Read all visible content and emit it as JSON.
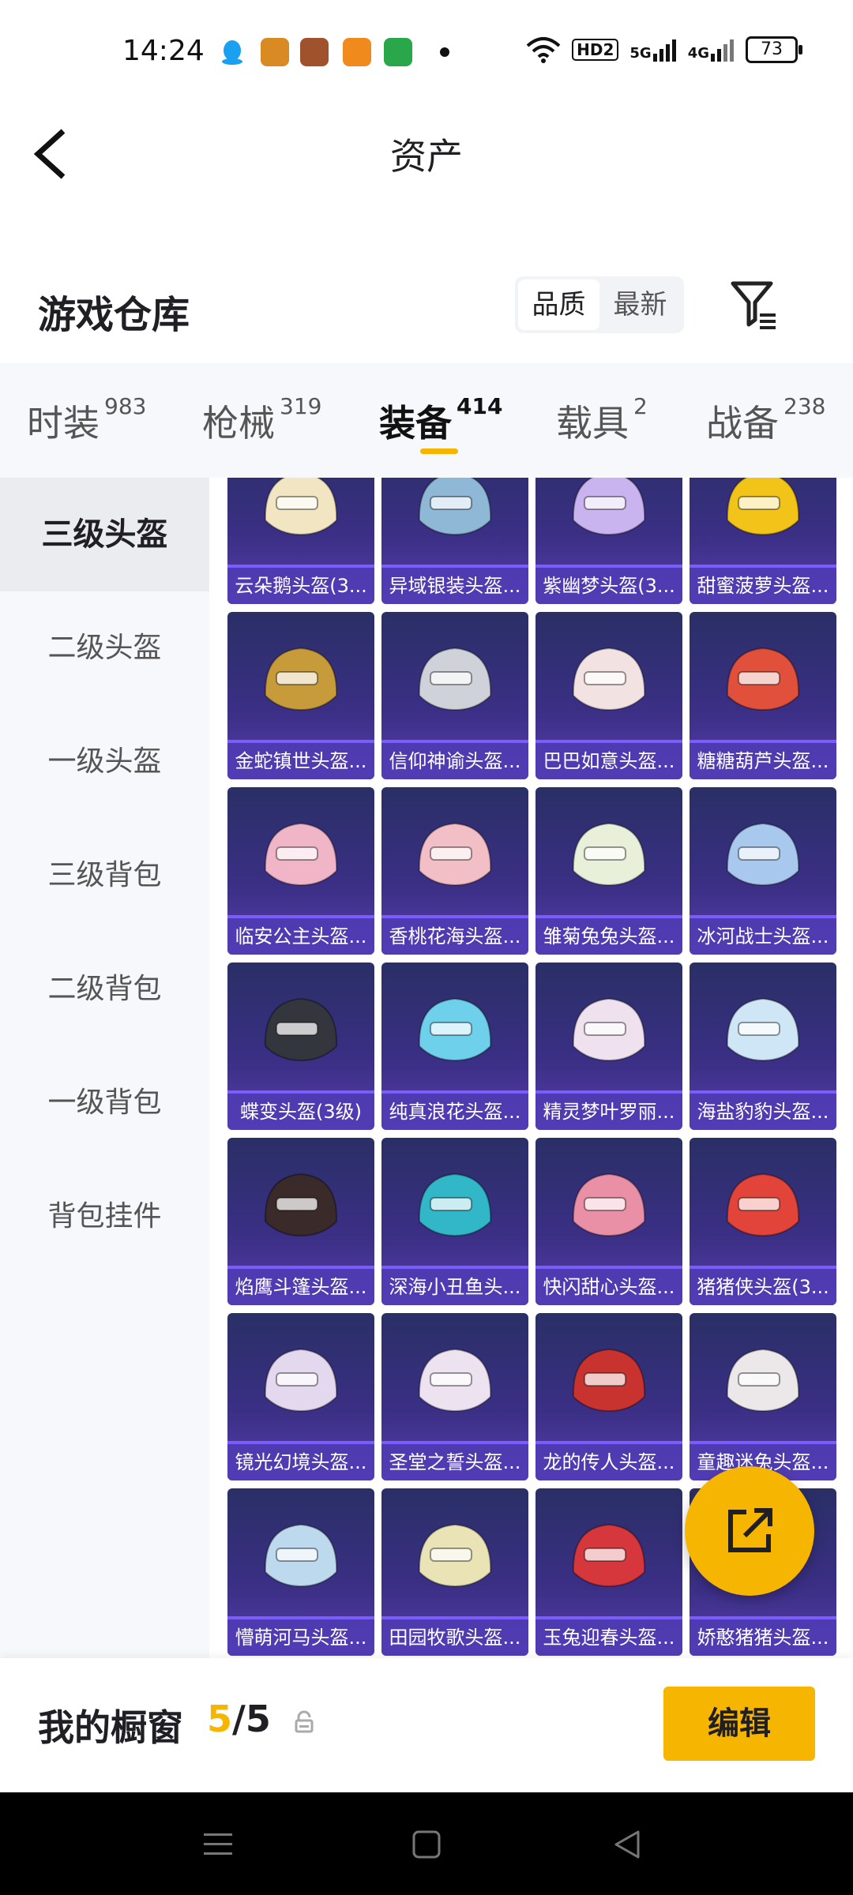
{
  "status_bar": {
    "time": "14:24",
    "hd": "HD2",
    "sig1": "5G",
    "sig2": "4G",
    "battery": "73"
  },
  "header": {
    "title": "资产"
  },
  "warehouse": {
    "title": "游戏仓库",
    "sort_options": [
      "品质",
      "最新"
    ],
    "active_sort": "品质"
  },
  "tabs": [
    {
      "label": "时装",
      "count": "983"
    },
    {
      "label": "枪械",
      "count": "319"
    },
    {
      "label": "装备",
      "count": "414"
    },
    {
      "label": "载具",
      "count": "2"
    },
    {
      "label": "战备",
      "count": "238"
    }
  ],
  "active_tab": "装备",
  "sidebar": {
    "items": [
      "三级头盔",
      "二级头盔",
      "一级头盔",
      "三级背包",
      "二级背包",
      "一级背包",
      "背包挂件"
    ],
    "active": "三级头盔"
  },
  "items": [
    {
      "name": "云朵鹅头盔(3...",
      "color": "#f2e6c2"
    },
    {
      "name": "异域银装头盔...",
      "color": "#8fb7d6"
    },
    {
      "name": "紫幽梦头盔(3...",
      "color": "#c9b4f0"
    },
    {
      "name": "甜蜜菠萝头盔...",
      "color": "#f2c318"
    },
    {
      "name": "金蛇镇世头盔...",
      "color": "#c79a3a"
    },
    {
      "name": "信仰神谕头盔...",
      "color": "#cfd2d8"
    },
    {
      "name": "巴巴如意头盔...",
      "color": "#f3e2e2"
    },
    {
      "name": "糖糖葫芦头盔...",
      "color": "#e0503a"
    },
    {
      "name": "临安公主头盔...",
      "color": "#f0b6c8"
    },
    {
      "name": "香桃花海头盔...",
      "color": "#f3bfc6"
    },
    {
      "name": "雏菊兔兔头盔...",
      "color": "#e9f0da"
    },
    {
      "name": "冰河战士头盔...",
      "color": "#a9c8ee"
    },
    {
      "name": "蝶变头盔(3级)",
      "color": "#34363d"
    },
    {
      "name": "纯真浪花头盔...",
      "color": "#6fd0ec"
    },
    {
      "name": "精灵梦叶罗丽...",
      "color": "#efe2ee"
    },
    {
      "name": "海盐豹豹头盔...",
      "color": "#cfe6f6"
    },
    {
      "name": "焰鹰斗篷头盔...",
      "color": "#3a2a2a"
    },
    {
      "name": "深海小丑鱼头...",
      "color": "#31b7c7"
    },
    {
      "name": "快闪甜心头盔...",
      "color": "#e98fa6"
    },
    {
      "name": "猪猪侠头盔(3...",
      "color": "#e2443a"
    },
    {
      "name": "镜光幻境头盔...",
      "color": "#e4d8ee"
    },
    {
      "name": "圣堂之誓头盔...",
      "color": "#ede3f0"
    },
    {
      "name": "龙的传人头盔...",
      "color": "#c8332f"
    },
    {
      "name": "童趣迷兔头盔...",
      "color": "#ece8ea"
    },
    {
      "name": "懵萌河马头盔...",
      "color": "#bcd9ee"
    },
    {
      "name": "田园牧歌头盔...",
      "color": "#e9e3b6"
    },
    {
      "name": "玉兔迎春头盔...",
      "color": "#d6373c"
    },
    {
      "name": "娇憨猪猪头盔...",
      "color": "#f0b3c3"
    }
  ],
  "showcase": {
    "title": "我的橱窗",
    "current": "5",
    "sep": "/",
    "total": "5",
    "edit_label": "编辑"
  },
  "colors": {
    "accent": "#f5b500",
    "card_bg": "#3b2f86"
  }
}
